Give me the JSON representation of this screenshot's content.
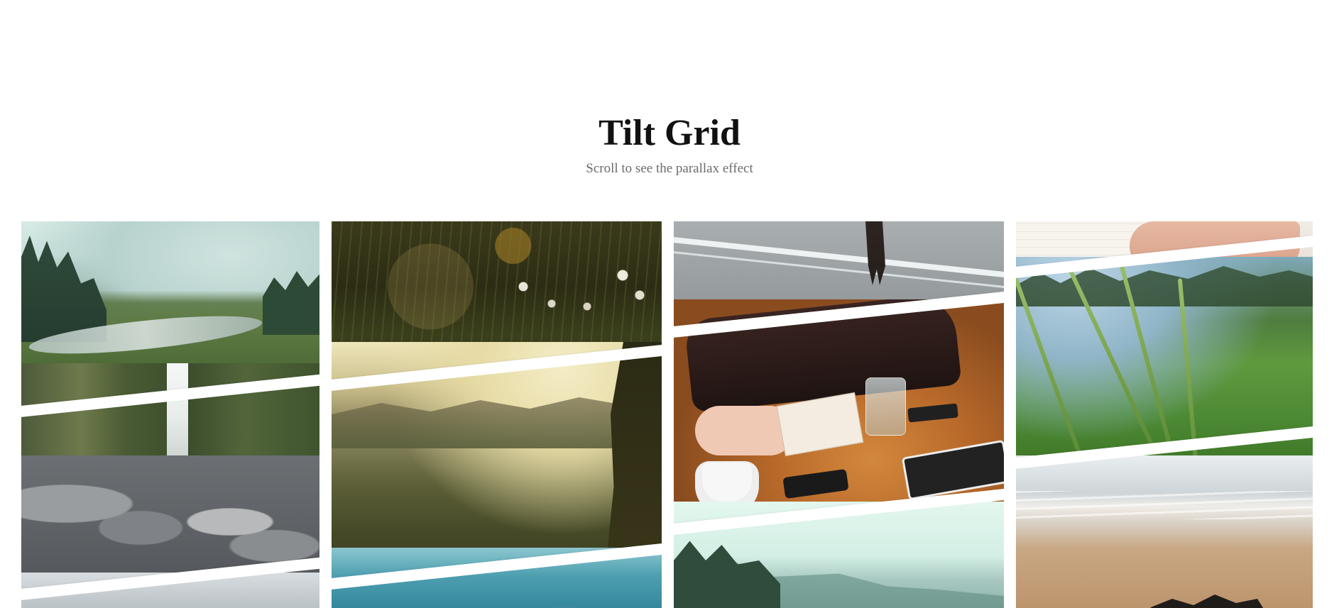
{
  "header": {
    "title": "Tilt Grid",
    "subtitle": "Scroll to see the parallax effect"
  },
  "grid": {
    "columns": [
      {
        "tiles": [
          {
            "name": "misty-river-valley"
          },
          {
            "name": "mossy-waterfall-rocks"
          },
          {
            "name": "snowy-mountains-partial"
          }
        ]
      },
      {
        "tiles": [
          {
            "name": "backlit-grass-flowers"
          },
          {
            "name": "tuscan-hills-sunrise"
          },
          {
            "name": "blue-mountain-lake-partial"
          }
        ]
      },
      {
        "tiles": [
          {
            "name": "person-walking-crosswalk"
          },
          {
            "name": "table-with-bag-notebook-glass"
          },
          {
            "name": "misty-forest-hills"
          }
        ]
      },
      {
        "tiles": [
          {
            "name": "hand-on-notebook"
          },
          {
            "name": "tall-grass-closeup"
          },
          {
            "name": "beach-rocks-shore"
          }
        ]
      }
    ]
  },
  "colors": {
    "background": "#ffffff",
    "title": "#111111",
    "subtitle": "#6b6b6b"
  }
}
